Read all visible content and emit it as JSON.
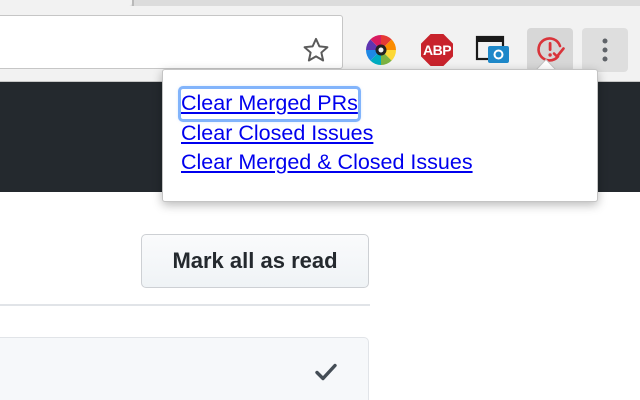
{
  "browser": {
    "toolbar": {
      "bookmark_star_icon": "star-outline-icon",
      "extensions": [
        {
          "name": "color-wheel-extension",
          "icon": "color-wheel-icon"
        },
        {
          "name": "adblock-plus-extension",
          "icon": "abp-icon",
          "badge_text": "ABP",
          "color": "#c8232c"
        },
        {
          "name": "screenshot-extension",
          "icon": "screenshot-icon",
          "color": "#1e88c9"
        },
        {
          "name": "notifier-extension",
          "icon": "alert-check-icon",
          "color": "#d9343a"
        }
      ],
      "menu_icon": "vertical-dots-icon"
    }
  },
  "popup": {
    "links": [
      {
        "label": "Clear Merged PRs",
        "focused": true
      },
      {
        "label": "Clear Closed Issues",
        "focused": false
      },
      {
        "label": "Clear Merged & Closed Issues",
        "focused": false
      }
    ]
  },
  "page": {
    "header_background": "#24292e",
    "mark_all_read_label": "Mark all as read",
    "notification_item": {
      "action_icon": "checkmark-icon"
    }
  },
  "colors": {
    "link": "#0000ee",
    "focus_ring": "#82b4fb",
    "abp_red": "#c8232c",
    "notifier_red": "#d9343a"
  }
}
